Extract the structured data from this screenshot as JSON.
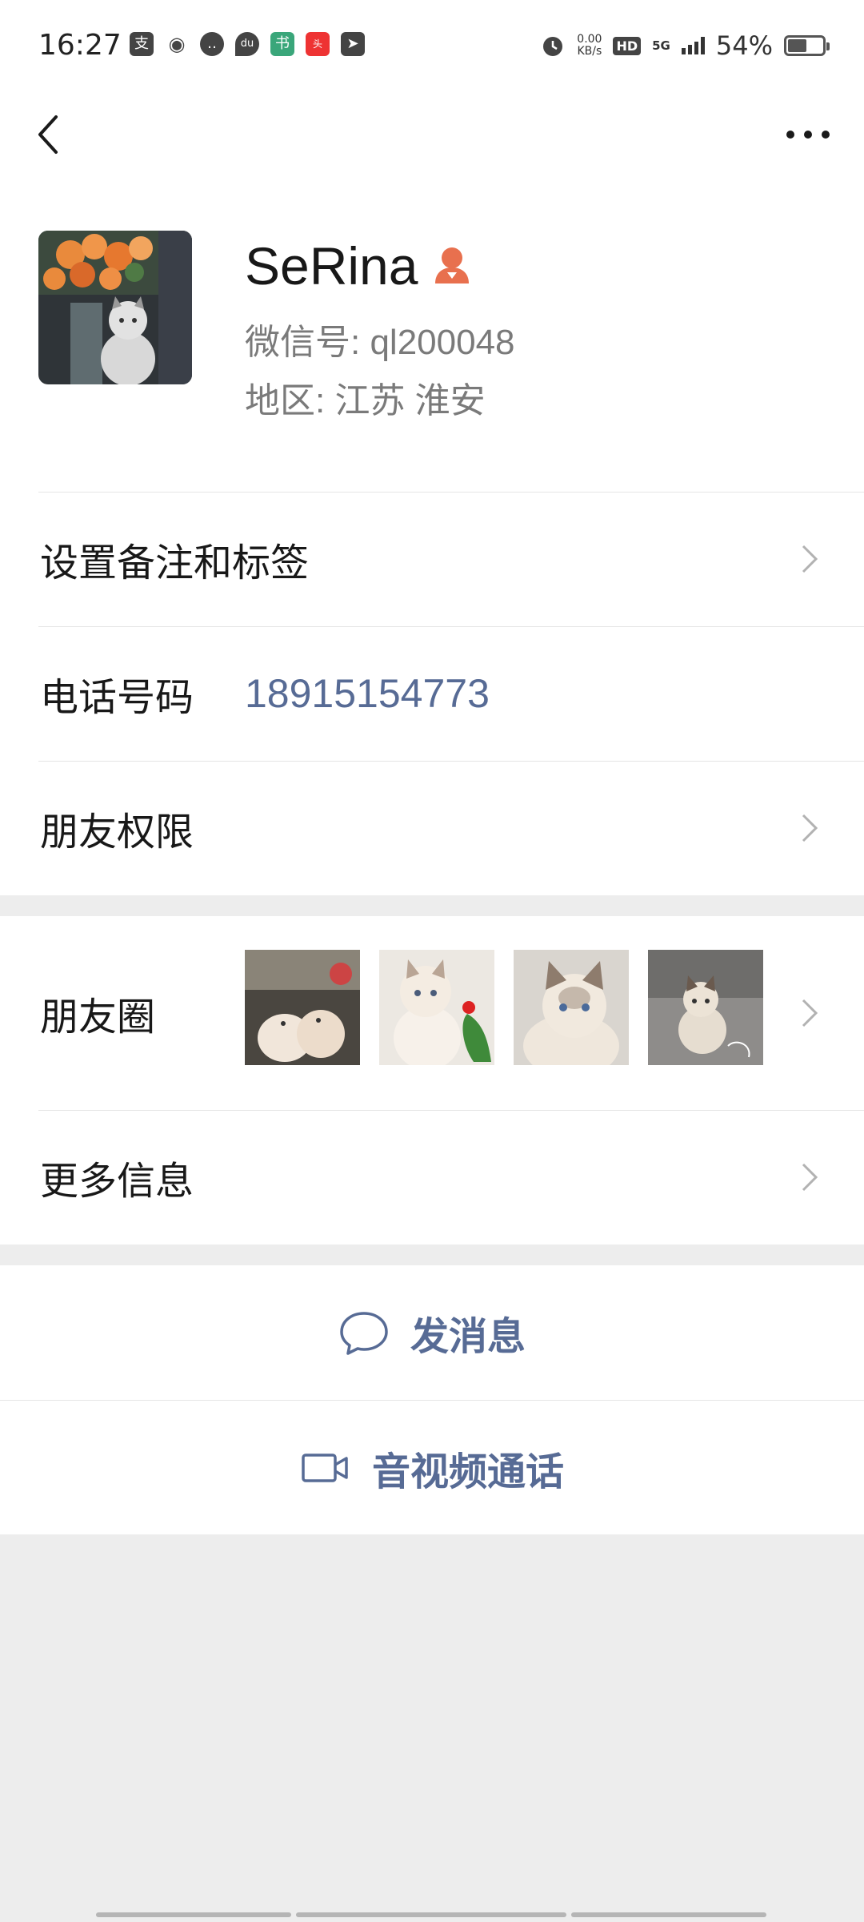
{
  "status_bar": {
    "time": "16:27",
    "net_speed_value": "0.00",
    "net_speed_unit": "KB/s",
    "hd": "HD",
    "network": "5G",
    "battery_text": "54%",
    "battery_level": 0.54,
    "app_icons": [
      "alipay-icon",
      "weibo-icon",
      "chat-icon",
      "du-map-icon",
      "app-icon",
      "toutiao-icon",
      "telegram-icon"
    ]
  },
  "nav": {
    "back_icon": "back-arrow-icon",
    "more_icon": "more-dots-icon"
  },
  "profile": {
    "name": "SeRina",
    "wechat_id": "微信号: ql200048",
    "region": "地区: 江苏  淮安",
    "gender_icon_color": "#e8704e"
  },
  "rows": {
    "remark_label": "设置备注和标签",
    "phone_label": "电话号码",
    "phone_value": "18915154773",
    "permissions_label": "朋友权限",
    "moments_label": "朋友圈",
    "more_info_label": "更多信息"
  },
  "actions": {
    "message_label": "发消息",
    "call_label": "音视频通话"
  },
  "colors": {
    "link_blue": "#576b95",
    "background_gray": "#ededed"
  }
}
